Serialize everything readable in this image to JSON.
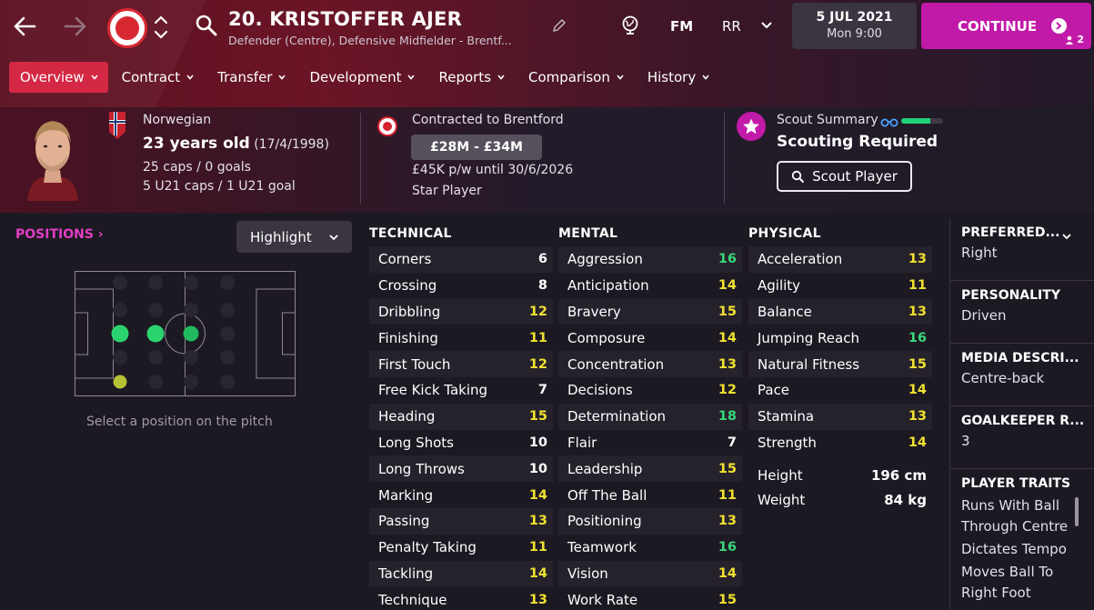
{
  "header": {
    "player_title": "20. KRISTOFFER AJER",
    "player_subtitle": "Defender (Centre), Defensive Midfielder - Brentf...",
    "fm_label": "FM",
    "rr_label": "RR",
    "date": "5 JUL 2021",
    "time": "Mon 9:00",
    "continue_label": "CONTINUE",
    "continue_count": "2"
  },
  "tabs": [
    "Overview",
    "Contract",
    "Transfer",
    "Development",
    "Reports",
    "Comparison",
    "History"
  ],
  "summary": {
    "nationality": "Norwegian",
    "age": "23 years old",
    "dob": "(17/4/1998)",
    "caps": "25 caps / 0 goals",
    "u21_caps": "5 U21 caps / 1 U21 goal",
    "contract": "Contracted to Brentford",
    "value": "£28M - £34M",
    "wage": "£45K p/w until 30/6/2026",
    "status": "Star Player",
    "scout_summary": "Scout Summary",
    "scout_status": "Scouting Required",
    "scout_button": "Scout Player",
    "scout_knowledge": 0.7
  },
  "positions": {
    "title": "POSITIONS",
    "highlight": "Highlight",
    "hint": "Select a position on the pitch"
  },
  "colors": {
    "accent": "#c21aa8",
    "tab_active": "#d21f3c",
    "high": "#3ad67c",
    "mid": "#f0e130"
  },
  "attributes": {
    "technical": {
      "title": "TECHNICAL",
      "rows": [
        {
          "name": "Corners",
          "value": "6"
        },
        {
          "name": "Crossing",
          "value": "8"
        },
        {
          "name": "Dribbling",
          "value": "12"
        },
        {
          "name": "Finishing",
          "value": "11"
        },
        {
          "name": "First Touch",
          "value": "12"
        },
        {
          "name": "Free Kick Taking",
          "value": "7"
        },
        {
          "name": "Heading",
          "value": "15"
        },
        {
          "name": "Long Shots",
          "value": "10"
        },
        {
          "name": "Long Throws",
          "value": "10"
        },
        {
          "name": "Marking",
          "value": "14"
        },
        {
          "name": "Passing",
          "value": "13"
        },
        {
          "name": "Penalty Taking",
          "value": "11"
        },
        {
          "name": "Tackling",
          "value": "14"
        },
        {
          "name": "Technique",
          "value": "13"
        }
      ]
    },
    "mental": {
      "title": "MENTAL",
      "rows": [
        {
          "name": "Aggression",
          "value": "16"
        },
        {
          "name": "Anticipation",
          "value": "14"
        },
        {
          "name": "Bravery",
          "value": "15"
        },
        {
          "name": "Composure",
          "value": "14"
        },
        {
          "name": "Concentration",
          "value": "13"
        },
        {
          "name": "Decisions",
          "value": "12"
        },
        {
          "name": "Determination",
          "value": "18"
        },
        {
          "name": "Flair",
          "value": "7"
        },
        {
          "name": "Leadership",
          "value": "15"
        },
        {
          "name": "Off The Ball",
          "value": "11"
        },
        {
          "name": "Positioning",
          "value": "13"
        },
        {
          "name": "Teamwork",
          "value": "16"
        },
        {
          "name": "Vision",
          "value": "14"
        },
        {
          "name": "Work Rate",
          "value": "15"
        }
      ]
    },
    "physical": {
      "title": "PHYSICAL",
      "rows": [
        {
          "name": "Acceleration",
          "value": "13"
        },
        {
          "name": "Agility",
          "value": "11"
        },
        {
          "name": "Balance",
          "value": "13"
        },
        {
          "name": "Jumping Reach",
          "value": "16"
        },
        {
          "name": "Natural Fitness",
          "value": "15"
        },
        {
          "name": "Pace",
          "value": "14"
        },
        {
          "name": "Stamina",
          "value": "13"
        },
        {
          "name": "Strength",
          "value": "14"
        }
      ],
      "height_label": "Height",
      "height_value": "196 cm",
      "weight_label": "Weight",
      "weight_value": "84 kg"
    }
  },
  "info": {
    "preferred_foot_head": "PREFERRED...",
    "preferred_foot": "Right",
    "personality_head": "PERSONALITY",
    "personality": "Driven",
    "media_head": "MEDIA DESCRI...",
    "media": "Centre-back",
    "gk_head": "GOALKEEPER R...",
    "gk": "3",
    "traits_head": "PLAYER TRAITS",
    "traits": [
      "Runs With Ball Through Centre",
      "Dictates Tempo",
      "Moves Ball To Right Foot"
    ]
  }
}
